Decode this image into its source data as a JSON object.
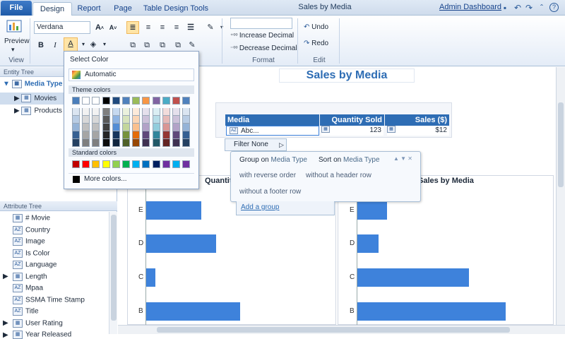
{
  "tabs": [
    "File",
    "Design",
    "Report",
    "Page",
    "Table Design Tools"
  ],
  "window_title": "Sales by Media",
  "admin_link": "Admin Dashboard",
  "ribbon": {
    "preview_label": "Preview",
    "view_label": "View",
    "font_name": "Verdana",
    "increase_decimal": "Increase Decimal",
    "decrease_decimal": "Decrease Decimal",
    "format_label": "Format",
    "undo": "Undo",
    "redo": "Redo",
    "edit_label": "Edit"
  },
  "entity_tree": {
    "title": "Entity Tree",
    "root": "Media Type",
    "items": [
      "Movies",
      "Products"
    ]
  },
  "attribute_tree": {
    "title": "Attribute Tree",
    "items": [
      {
        "label": "# Movie",
        "icon": "grid-icon"
      },
      {
        "label": "Country",
        "icon": "az-icon"
      },
      {
        "label": "Image",
        "icon": "az-icon"
      },
      {
        "label": "Is Color",
        "icon": "az-icon"
      },
      {
        "label": "Language",
        "icon": "az-icon"
      },
      {
        "label": "Length",
        "icon": "grid-icon"
      },
      {
        "label": "Mpaa",
        "icon": "az-icon"
      },
      {
        "label": "SSMA Time Stamp",
        "icon": "az-icon"
      },
      {
        "label": "Title",
        "icon": "az-icon"
      },
      {
        "label": "User Rating",
        "icon": "grid-icon"
      },
      {
        "label": "Year Released",
        "icon": "grid-icon"
      }
    ]
  },
  "report": {
    "title": "Sales by Media",
    "table": {
      "headers": [
        "Media",
        "Quantity Sold",
        "Sales ($)"
      ],
      "row": [
        "Abc...",
        "123",
        "$12"
      ]
    },
    "filter_label": "Filter None",
    "group_popup": {
      "group_on": "Group on",
      "group_on_value": "Media Type",
      "sort_on": "Sort on",
      "sort_on_value": "Media Type",
      "opt_reverse": "with reverse order",
      "opt_no_header": "without a header row",
      "opt_no_footer": "without a footer row"
    },
    "add_group": "Add a group",
    "chart_left_title": "Quantity So",
    "chart_right_title": "Sales by Media"
  },
  "chart_data": [
    {
      "type": "bar",
      "title": "Quantity So",
      "categories": [
        "E",
        "D",
        "C",
        "B"
      ],
      "values": [
        95,
        121,
        16,
        162
      ]
    },
    {
      "type": "bar",
      "title": "Sales by Media",
      "categories": [
        "E",
        "D",
        "C",
        "B"
      ],
      "values": [
        42,
        30,
        158,
        210
      ]
    }
  ],
  "color_picker": {
    "title": "Select Color",
    "automatic": "Automatic",
    "theme_colors_label": "Theme colors",
    "standard_colors_label": "Standard colors",
    "more_colors": "More colors...",
    "theme_top": [
      "#4a7ebb",
      "#ffffff",
      "#ffffff",
      "#000000",
      "#1f497d",
      "#4f81bd",
      "#9bbb59",
      "#f79646",
      "#8064a2",
      "#4bacc6",
      "#c0504d",
      "#4f81bd"
    ],
    "theme_cols": [
      [
        "#dbe5f1",
        "#b8cce4",
        "#95b3d7",
        "#366092",
        "#244061"
      ],
      [
        "#f2f2f2",
        "#d8d8d8",
        "#bfbfbf",
        "#a5a5a5",
        "#7f7f7f"
      ],
      [
        "#f2f2f2",
        "#d8d8d8",
        "#bfbfbf",
        "#a5a5a5",
        "#7f7f7f"
      ],
      [
        "#7f7f7f",
        "#595959",
        "#3f3f3f",
        "#262626",
        "#0c0c0c"
      ],
      [
        "#c6d9f0",
        "#8db3e2",
        "#548dd4",
        "#17365d",
        "#0f243e"
      ],
      [
        "#ebf1dd",
        "#d7e3bc",
        "#c3d69b",
        "#76923c",
        "#4f6128"
      ],
      [
        "#fdeada",
        "#fbd5b5",
        "#fac08f",
        "#e36c09",
        "#974806"
      ],
      [
        "#e5e0ec",
        "#ccc1d9",
        "#b2a2c7",
        "#5f497a",
        "#3f3151"
      ],
      [
        "#dbeef3",
        "#b7dde8",
        "#92cddc",
        "#31859b",
        "#205867"
      ],
      [
        "#f2dcdb",
        "#e5b9b7",
        "#d99694",
        "#953734",
        "#632423"
      ],
      [
        "#e5e0ec",
        "#ccc1d9",
        "#b2a2c7",
        "#5f497a",
        "#3f3151"
      ],
      [
        "#dbe5f1",
        "#b8cce4",
        "#95b3d7",
        "#366092",
        "#244061"
      ]
    ],
    "standard": [
      "#c00000",
      "#ff0000",
      "#ffc000",
      "#ffff00",
      "#92d050",
      "#00b050",
      "#00b0f0",
      "#0070c0",
      "#002060",
      "#7030a0",
      "#00b0f0",
      "#7030a0"
    ]
  }
}
